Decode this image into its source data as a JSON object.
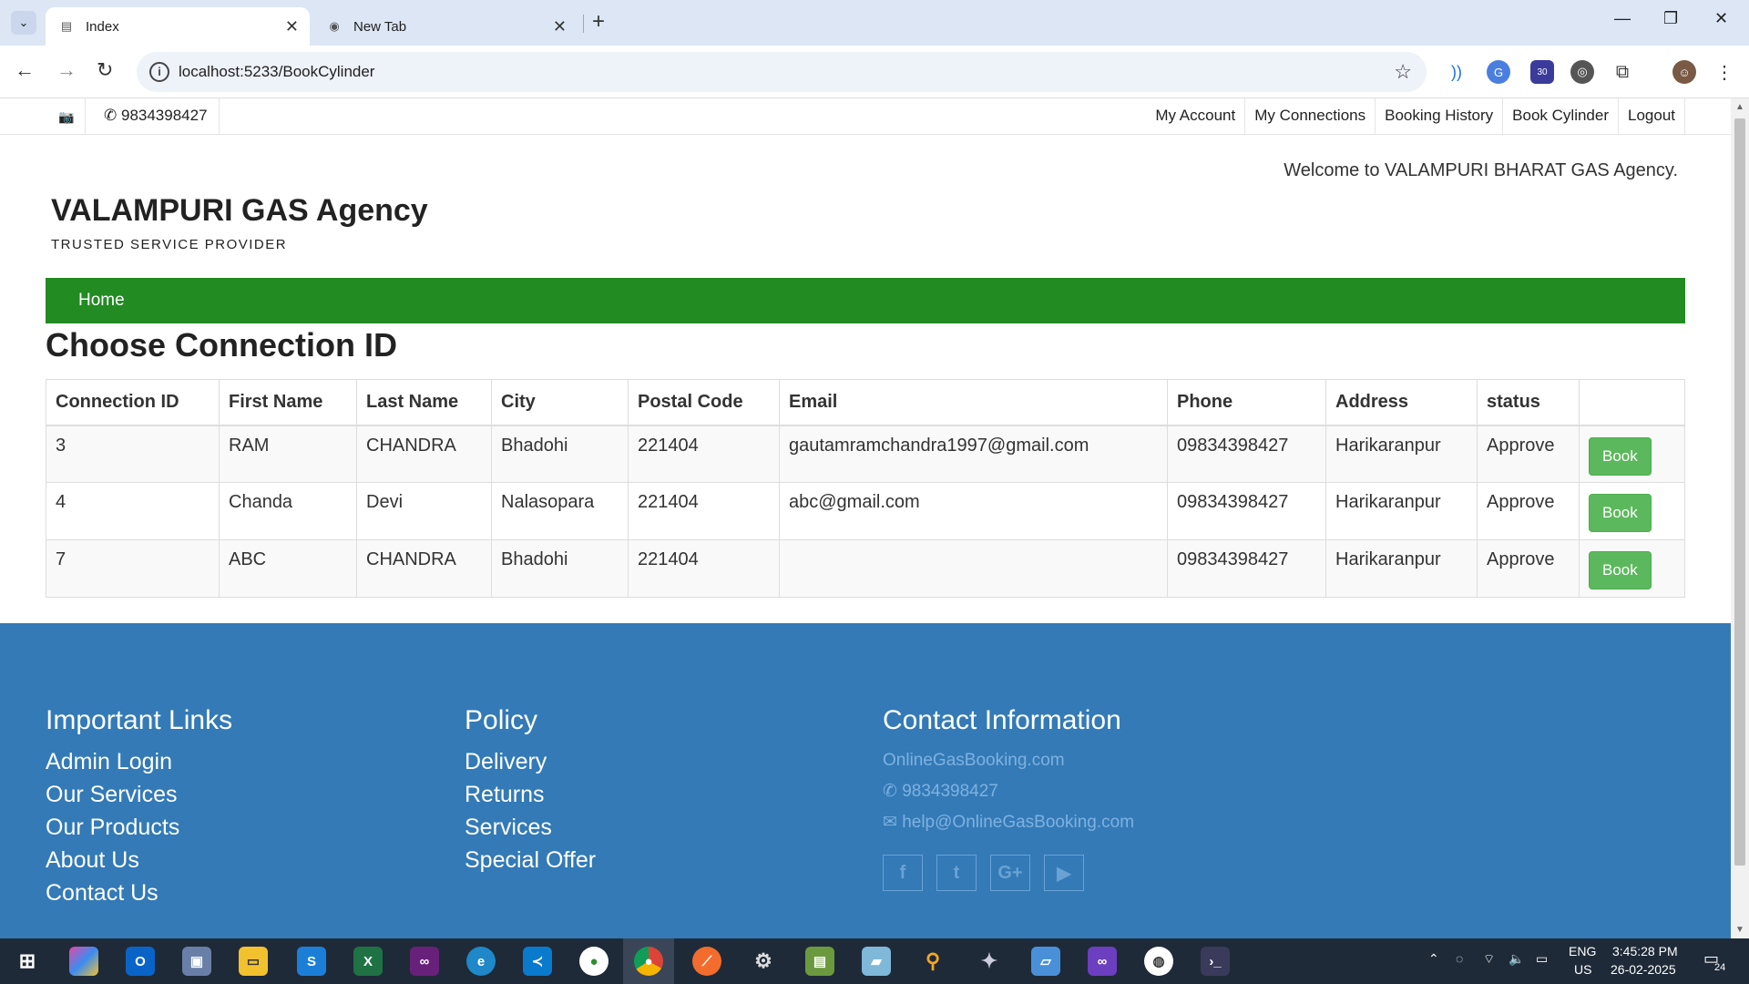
{
  "browser": {
    "tabs": [
      {
        "title": "Index",
        "active": true
      },
      {
        "title": "New Tab",
        "active": false
      }
    ],
    "url": "localhost:5233/BookCylinder",
    "extension_badge": "30"
  },
  "site": {
    "phone": "9834398427",
    "top_links": [
      "My Account",
      "My Connections",
      "Booking History",
      "Book Cylinder",
      "Logout"
    ],
    "welcome": "Welcome to VALAMPURI BHARAT GAS Agency.",
    "brand": "VALAMPURI GAS Agency",
    "tagline": "TRUSTED SERVICE PROVIDER",
    "nav_home": "Home",
    "heading": "Choose Connection ID",
    "accent_green": "#228b22",
    "footer_blue": "#337ab7"
  },
  "table": {
    "headers": [
      "Connection ID",
      "First Name",
      "Last Name",
      "City",
      "Postal Code",
      "Email",
      "Phone",
      "Address",
      "status",
      ""
    ],
    "rows": [
      {
        "id": "3",
        "first": "RAM",
        "last": "CHANDRA",
        "city": "Bhadohi",
        "postal": "221404",
        "email": "gautamramchandra1997@gmail.com",
        "phone": "09834398427",
        "address": "Harikaranpur",
        "status": "Approve",
        "action": "Book"
      },
      {
        "id": "4",
        "first": "Chanda",
        "last": "Devi",
        "city": "Nalasopara",
        "postal": "221404",
        "email": "abc@gmail.com",
        "phone": "09834398427",
        "address": "Harikaranpur",
        "status": "Approve",
        "action": "Book"
      },
      {
        "id": "7",
        "first": "ABC",
        "last": "CHANDRA",
        "city": "Bhadohi",
        "postal": "221404",
        "email": "",
        "phone": "09834398427",
        "address": "Harikaranpur",
        "status": "Approve",
        "action": "Book"
      }
    ]
  },
  "footer": {
    "important": {
      "title": "Important Links",
      "links": [
        "Admin Login",
        "Our Services",
        "Our Products",
        "About Us",
        "Contact Us"
      ]
    },
    "policy": {
      "title": "Policy",
      "links": [
        "Delivery",
        "Returns",
        "Services",
        "Special Offer"
      ]
    },
    "contact": {
      "title": "Contact Information",
      "site": "OnlineGasBooking.com",
      "phone": "9834398427",
      "email": "help@OnlineGasBooking.com"
    },
    "social_icons": [
      "facebook-icon",
      "twitter-icon",
      "google-plus-icon",
      "youtube-icon"
    ]
  },
  "taskbar": {
    "lang": "ENG",
    "region": "US",
    "time": "3:45:28 PM",
    "date": "26-02-2025",
    "notifications": "24"
  }
}
